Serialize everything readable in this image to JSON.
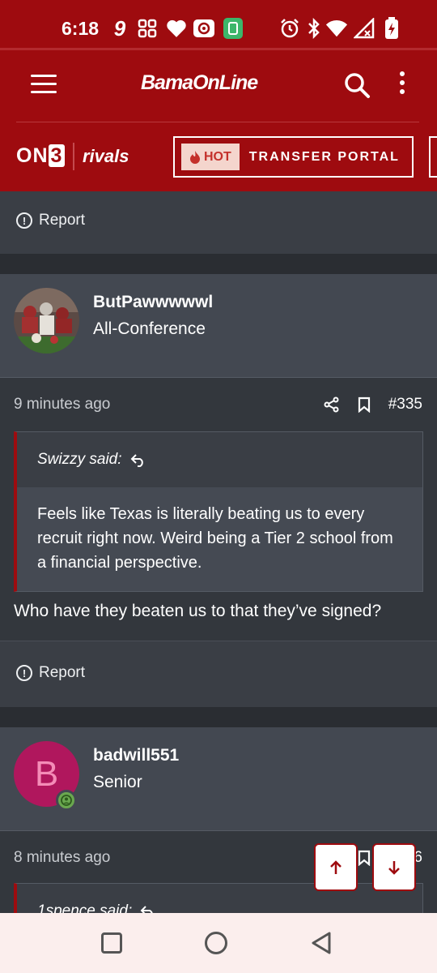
{
  "status_bar": {
    "time": "6:18",
    "icons": [
      "nine-app-icon",
      "grid-app-icon",
      "heart-icon",
      "radio-icon",
      "battery-saver-icon",
      "alarm-icon",
      "bluetooth-icon",
      "wifi-icon",
      "signal-icon",
      "battery-icon"
    ]
  },
  "header": {
    "logo_text": "BamaOnLine",
    "on3_prefix": "ON",
    "on3_suffix": "3",
    "rivals_text": "rivals",
    "hot_label": "HOT",
    "portal_label": "TRANSFER PORTAL"
  },
  "posts": [
    {
      "report_label": "Report"
    },
    {
      "username": "ButPawwwwwl",
      "rank": "All-Conference",
      "time": "9 minutes ago",
      "post_number": "#335",
      "quote_author": "Swizzy said:",
      "quote_text": "Feels like Texas is literally beating us to every recruit right now. Weird being a Tier 2 school from a financial perspective.",
      "reply_text": "Who have they beaten us to that they’ve signed?",
      "report_label": "Report"
    },
    {
      "username": "badwill551",
      "rank": "Senior",
      "avatar_letter": "B",
      "time": "8 minutes ago",
      "post_number": "#336",
      "quote_author": "1spence said:"
    }
  ],
  "colors": {
    "brand_red": "#9e0b0f",
    "avatar_pink": "#b0175d",
    "online_green": "#6aa84f"
  }
}
